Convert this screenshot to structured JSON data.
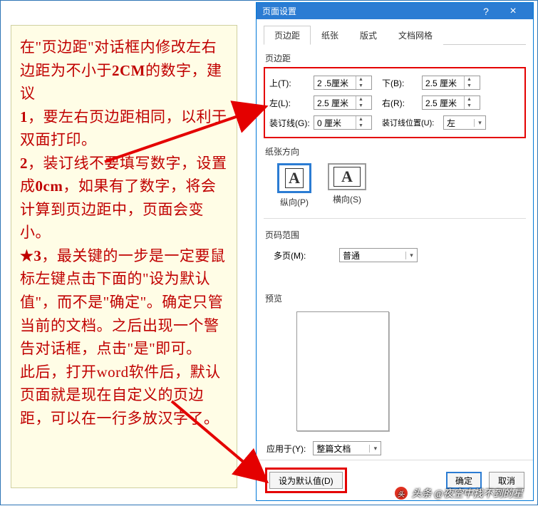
{
  "annotation": {
    "p1": "在\"页边距\"对话框内修改左右边距为不小于",
    "p1b": "2CM",
    "p1c": "的数字，建议",
    "n1": "1",
    "t1": "，要左右页边距相同，以利于双面打印。",
    "n2": "2",
    "t2a": "，装订线不要填写数字，设置成",
    "t2b": "0cm",
    "t2c": "，如果有了数字，将会计算到页边距中，页面会变小。",
    "n3": "★3",
    "t3": "，最关键的一步是一定要鼠标左键点击下面的\"设为默认值\"，而不是\"确定\"。确定只管当前的文档。之后出现一个警告对话框，点击\"是\"即可。",
    "t4": "此后，打开word软件后，默认页面就是现在自定义的页边距，可以在一行多放汉字了。"
  },
  "dialog": {
    "title": "页面设置",
    "help": "?",
    "close": "×",
    "tabs": [
      "页边距",
      "纸张",
      "版式",
      "文档网格"
    ],
    "margins": {
      "group_label": "页边距",
      "top_label": "上(T):",
      "top_value": "2 .5厘米",
      "bottom_label": "下(B):",
      "bottom_value": "2.5 厘米",
      "left_label": "左(L):",
      "left_value": "2.5 厘米",
      "right_label": "右(R):",
      "right_value": "2.5 厘米",
      "gutter_label": "装订线(G):",
      "gutter_value": "0 厘米",
      "gutter_pos_label": "装订线位置(U):",
      "gutter_pos_value": "左"
    },
    "orientation": {
      "group_label": "纸张方向",
      "portrait": "纵向(P)",
      "landscape": "横向(S)",
      "glyph": "A"
    },
    "pages": {
      "group_label": "页码范围",
      "multi_label": "多页(M):",
      "multi_value": "普通"
    },
    "preview_label": "预览",
    "apply": {
      "label": "应用于(Y):",
      "value": "整篇文档"
    },
    "buttons": {
      "set_default": "设为默认值(D)",
      "ok": "确定",
      "cancel": "取消"
    }
  },
  "watermark": "头条 @夜空中找不到的星"
}
